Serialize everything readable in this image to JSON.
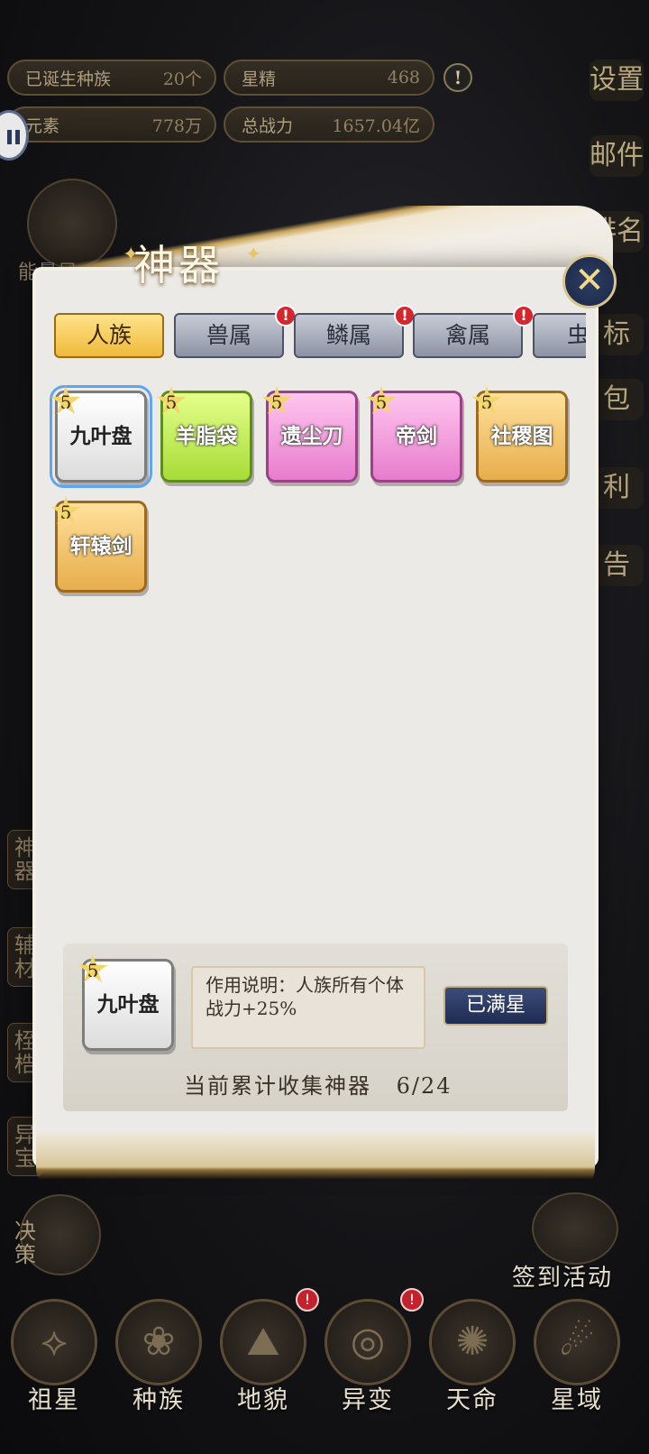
{
  "stats": [
    {
      "label": "已诞生种族",
      "value": "20个"
    },
    {
      "label": "星精",
      "value": "468"
    },
    {
      "label": "元素",
      "value": "778万"
    },
    {
      "label": "总战力",
      "value": "1657.04亿"
    }
  ],
  "alert_symbol": "!",
  "right_menu": [
    "设置",
    "邮件",
    "排名",
    "标",
    "包",
    "利",
    "告"
  ],
  "left_menu": [
    "神器",
    "辅材",
    "桎梏",
    "异宝",
    "决策"
  ],
  "left_partial_label": "能量风",
  "panel": {
    "title": "神器",
    "close_symbol": "✕",
    "tabs": [
      {
        "label": "人族",
        "active": true,
        "badge": false
      },
      {
        "label": "兽属",
        "active": false,
        "badge": true
      },
      {
        "label": "鳞属",
        "active": false,
        "badge": true
      },
      {
        "label": "禽属",
        "active": false,
        "badge": true
      },
      {
        "label": "虫",
        "active": false,
        "badge": false
      }
    ],
    "badge_symbol": "!",
    "artifacts": [
      {
        "name": "九叶盘",
        "stars": "5",
        "rarity": "white",
        "selected": true
      },
      {
        "name": "羊脂袋",
        "stars": "5",
        "rarity": "green",
        "selected": false
      },
      {
        "name": "遗尘刀",
        "stars": "5",
        "rarity": "pink",
        "selected": false
      },
      {
        "name": "帝剑",
        "stars": "5",
        "rarity": "pink",
        "selected": false
      },
      {
        "name": "社稷图",
        "stars": "5",
        "rarity": "gold",
        "selected": false
      },
      {
        "name": "轩辕剑",
        "stars": "5",
        "rarity": "gold",
        "selected": false
      }
    ],
    "detail": {
      "name": "九叶盘",
      "stars": "5",
      "description": "作用说明：人族所有个体战力+25%",
      "status_button": "已满星",
      "collect_label": "当前累计收集神器",
      "collect_count": "6/24"
    }
  },
  "sign_in": "签到活动",
  "bottom_nav": [
    {
      "label": "祖星",
      "badge": false
    },
    {
      "label": "种族",
      "badge": false
    },
    {
      "label": "地貌",
      "badge": true
    },
    {
      "label": "异变",
      "badge": true
    },
    {
      "label": "天命",
      "badge": false
    },
    {
      "label": "星域",
      "badge": false
    }
  ]
}
